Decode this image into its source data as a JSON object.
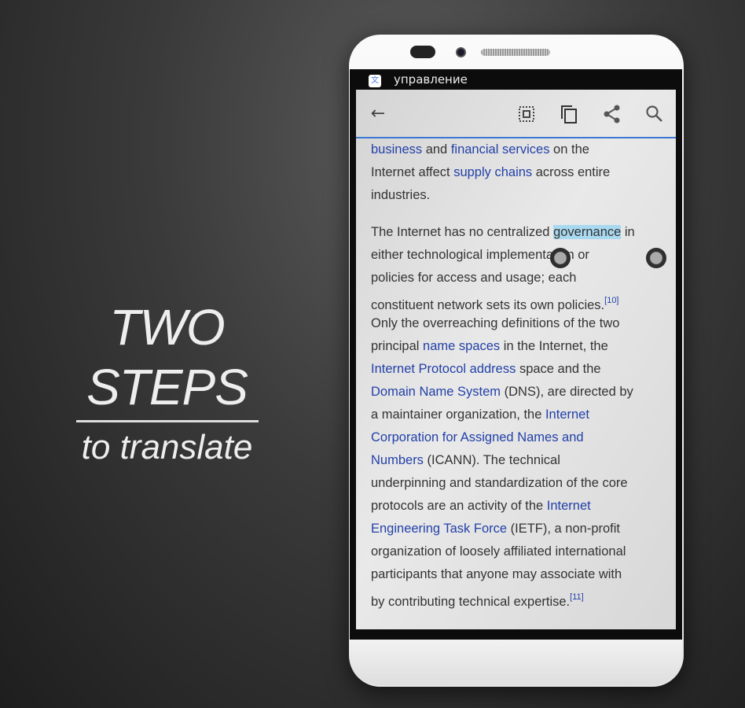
{
  "promo": {
    "title": "TWO STEPS",
    "subtitle": "to translate"
  },
  "status_bar": {
    "app_icon": "translate-app-icon",
    "title": "управление"
  },
  "toolbar": {
    "icons": [
      "back-arrow-icon",
      "select-all-icon",
      "copy-icon",
      "share-icon",
      "search-icon"
    ]
  },
  "colors": {
    "link": "#2341a8",
    "selection": "#a9d9f0",
    "accent": "#3b78d4"
  },
  "article": {
    "paragraphs": [
      [
        [
          {
            "t": "business",
            "link": true
          },
          {
            "t": " and "
          },
          {
            "t": "financial services",
            "link": true
          },
          {
            "t": " on the"
          }
        ],
        [
          {
            "t": "Internet affect "
          },
          {
            "t": "supply chains",
            "link": true
          },
          {
            "t": " across entire"
          }
        ],
        [
          {
            "t": "industries."
          }
        ]
      ],
      [
        [
          {
            "t": "The Internet has no centralized "
          },
          {
            "t": "governance",
            "selected": true
          },
          {
            "t": " in"
          }
        ],
        [
          {
            "t": "either technological implementation or"
          }
        ],
        [
          {
            "t": "policies for access and usage; each"
          }
        ],
        [
          {
            "t": "constituent network sets its own policies."
          },
          {
            "t": "[10]",
            "sup": true
          }
        ],
        [
          {
            "t": "Only the overreaching definitions of the two"
          }
        ],
        [
          {
            "t": "principal "
          },
          {
            "t": "name spaces",
            "link": true
          },
          {
            "t": " in the Internet, the"
          }
        ],
        [
          {
            "t": "Internet Protocol address",
            "link": true
          },
          {
            "t": " space and the"
          }
        ],
        [
          {
            "t": "Domain Name System",
            "link": true
          },
          {
            "t": " (DNS), are directed by"
          }
        ],
        [
          {
            "t": "a maintainer organization, the "
          },
          {
            "t": "Internet",
            "link": true
          }
        ],
        [
          {
            "t": "Corporation for Assigned Names and",
            "link": true
          }
        ],
        [
          {
            "t": "Numbers",
            "link": true
          },
          {
            "t": " (ICANN). The technical"
          }
        ],
        [
          {
            "t": "underpinning and standardization of the core"
          }
        ],
        [
          {
            "t": "protocols are an activity of the "
          },
          {
            "t": "Internet",
            "link": true
          }
        ],
        [
          {
            "t": "Engineering Task Force",
            "link": true
          },
          {
            "t": " (IETF), a non-profit"
          }
        ],
        [
          {
            "t": "organization of loosely affiliated international"
          }
        ],
        [
          {
            "t": "participants that anyone may associate with"
          }
        ],
        [
          {
            "t": "by contributing technical expertise."
          },
          {
            "t": "[11]",
            "sup": true
          }
        ]
      ]
    ]
  }
}
